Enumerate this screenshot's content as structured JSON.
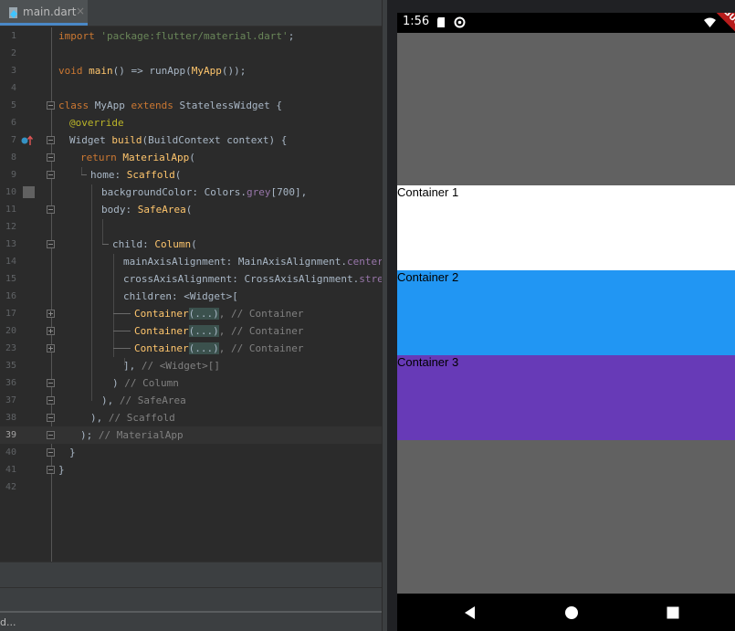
{
  "editor": {
    "tab_label": "main.dart",
    "tab_close": "×",
    "status_text": "d...",
    "lines": [
      {
        "n": "1"
      },
      {
        "n": "2"
      },
      {
        "n": "3"
      },
      {
        "n": "4"
      },
      {
        "n": "5"
      },
      {
        "n": "6"
      },
      {
        "n": "7"
      },
      {
        "n": "8"
      },
      {
        "n": "9"
      },
      {
        "n": "10"
      },
      {
        "n": "11"
      },
      {
        "n": "12"
      },
      {
        "n": "13"
      },
      {
        "n": "14"
      },
      {
        "n": "15"
      },
      {
        "n": "16"
      },
      {
        "n": "17"
      },
      {
        "n": "20"
      },
      {
        "n": "23"
      },
      {
        "n": "35"
      },
      {
        "n": "36"
      },
      {
        "n": "37"
      },
      {
        "n": "38"
      },
      {
        "n": "39"
      },
      {
        "n": "40"
      },
      {
        "n": "41"
      },
      {
        "n": "42"
      }
    ],
    "code": {
      "l1_kw": "import",
      "l1_str": "'package:flutter/material.dart'",
      "l1_end": ";",
      "l3_kw": "void",
      "l3_fn": "main",
      "l3_mid": "() => runApp(",
      "l3_cls": "MyApp",
      "l3_end": "());",
      "l5_kw1": "class",
      "l5_a": " MyApp ",
      "l5_kw2": "extends",
      "l5_b": " StatelessWidget {",
      "l6_ann": "@override",
      "l7_a": "Widget ",
      "l7_fn": "build",
      "l7_b": "(BuildContext context) {",
      "l8_kw": "return",
      "l8_cls": "MaterialApp",
      "l8_end": "(",
      "l9_a": "home: ",
      "l9_cls": "Scaffold",
      "l9_end": "(",
      "l10_a": "backgroundColor: Colors.",
      "l10_prop": "grey",
      "l10_end": "[700],",
      "l11_a": "body: ",
      "l11_cls": "SafeArea",
      "l11_end": "(",
      "l13_a": "child: ",
      "l13_cls": "Column",
      "l13_end": "(",
      "l14_a": "mainAxisAlignment: MainAxisAlignment.",
      "l14_prop": "center",
      "l14_end": ",",
      "l15_a": "crossAxisAlignment: CrossAxisAlignment.",
      "l15_prop": "stretch",
      "l15_end": ",",
      "l16_a": "children: <Widget>[",
      "container_cls": "Container",
      "fold_placeholder": "(...)",
      "container_cmt": ", // Container",
      "l35_a": "], ",
      "l35_cmt": "// <Widget>[]",
      "l36_a": ") ",
      "l36_cmt": "// Column",
      "l37_a": "), ",
      "l37_cmt": "// SafeArea",
      "l38_a": "), ",
      "l38_cmt": "// Scaffold",
      "l39_a": "); ",
      "l39_cmt": "// MaterialApp",
      "l40": "}",
      "l41": "}"
    }
  },
  "emulator": {
    "time": "1:56",
    "debug_banner": "DEBUG",
    "background_color": "#616161",
    "containers": [
      {
        "label": "Container 1",
        "color": "#ffffff"
      },
      {
        "label": "Container 2",
        "color": "#2196f3"
      },
      {
        "label": "Container 3",
        "color": "#673ab7"
      }
    ]
  }
}
